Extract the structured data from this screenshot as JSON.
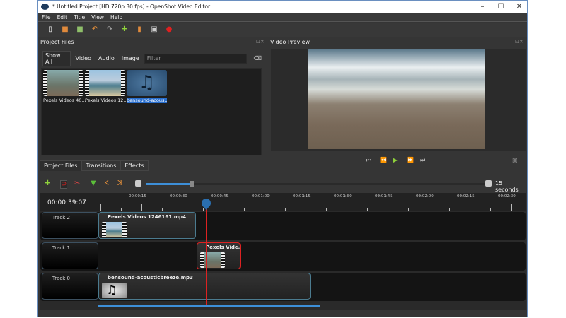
{
  "window": {
    "title": "* Untitled Project [HD 720p 30 fps] - OpenShot Video Editor",
    "minimize": "–",
    "maximize": "☐",
    "close": "✕"
  },
  "menu": [
    "File",
    "Edit",
    "Title",
    "View",
    "Help"
  ],
  "toolbar": [
    {
      "icon": "new-project-icon",
      "glyph": "▯",
      "color": "#eeeeee"
    },
    {
      "icon": "open-project-icon",
      "glyph": "■",
      "color": "#e08a3c"
    },
    {
      "icon": "save-project-icon",
      "glyph": "■",
      "color": "#8fbf6a"
    },
    {
      "icon": "undo-icon",
      "glyph": "↶",
      "color": "#e8913a"
    },
    {
      "icon": "redo-icon",
      "glyph": "↷",
      "color": "#aaaaaa"
    },
    {
      "icon": "import-files-icon",
      "glyph": "✚",
      "color": "#8fd13b"
    },
    {
      "icon": "profile-icon",
      "glyph": "▮",
      "color": "#e08a3c"
    },
    {
      "icon": "fullscreen-icon",
      "glyph": "▣",
      "color": "#cccccc"
    },
    {
      "icon": "export-icon",
      "glyph": "●",
      "color": "#e02020"
    }
  ],
  "project_files": {
    "title": "Project Files",
    "filters": [
      "Show All",
      "Video",
      "Audio",
      "Image"
    ],
    "filter_placeholder": "Filter",
    "clear_glyph": "⌫",
    "files": [
      {
        "name": "Pexels Videos 40...",
        "type": "video"
      },
      {
        "name": "Pexels Videos 12...",
        "type": "video"
      },
      {
        "name": "bensound-acous...",
        "type": "audio",
        "selected": true
      }
    ]
  },
  "video_preview": {
    "title": "Video Preview",
    "controls": [
      {
        "icon": "jump-start-icon",
        "glyph": "⏮"
      },
      {
        "icon": "rewind-icon",
        "glyph": "⏪"
      },
      {
        "icon": "play-icon",
        "glyph": "▶"
      },
      {
        "icon": "fast-forward-icon",
        "glyph": "⏩"
      },
      {
        "icon": "jump-end-icon",
        "glyph": "⏭"
      }
    ],
    "snapshot_glyph": "◙"
  },
  "tabs": [
    "Project Files",
    "Transitions",
    "Effects"
  ],
  "timeline": {
    "timecode": "00:00:39:07",
    "zoom_label": "15 seconds",
    "zoom_level": 0.13,
    "ruler_labels": [
      "00:00:15",
      "00:00:30",
      "00:00:45",
      "00:01:00",
      "00:01:15",
      "00:01:30",
      "00:01:45",
      "00:02:00",
      "00:02:15",
      "00:02:30"
    ],
    "tracks": [
      {
        "name": "Track 2",
        "clips": [
          {
            "name": "Pexels Videos 1246161.mp4",
            "type": "video"
          }
        ]
      },
      {
        "name": "Track 1",
        "clips": [
          {
            "name": "Pexels Vide...",
            "type": "video",
            "selected": true
          }
        ]
      },
      {
        "name": "Track 0",
        "clips": [
          {
            "name": "bensound-acousticbreeze.mp3",
            "type": "audio"
          }
        ]
      }
    ],
    "tools": [
      {
        "icon": "add-track-icon",
        "glyph": "✚",
        "color": "#8fd13b"
      },
      {
        "icon": "snapping-icon",
        "glyph": "⊃",
        "color": "#e02020"
      },
      {
        "icon": "razor-icon",
        "glyph": "✂",
        "color": "#cc4444"
      },
      {
        "icon": "add-marker-icon",
        "glyph": "▼",
        "color": "#5cbf3a"
      },
      {
        "icon": "previous-marker-icon",
        "glyph": "K",
        "color": "#e8913a"
      },
      {
        "icon": "next-marker-icon",
        "glyph": "K",
        "color": "#e8913a"
      }
    ]
  },
  "colors": {
    "accent": "#3d8fd8",
    "playhead": "#dd2222",
    "clip_border": "#4b7b8f"
  }
}
